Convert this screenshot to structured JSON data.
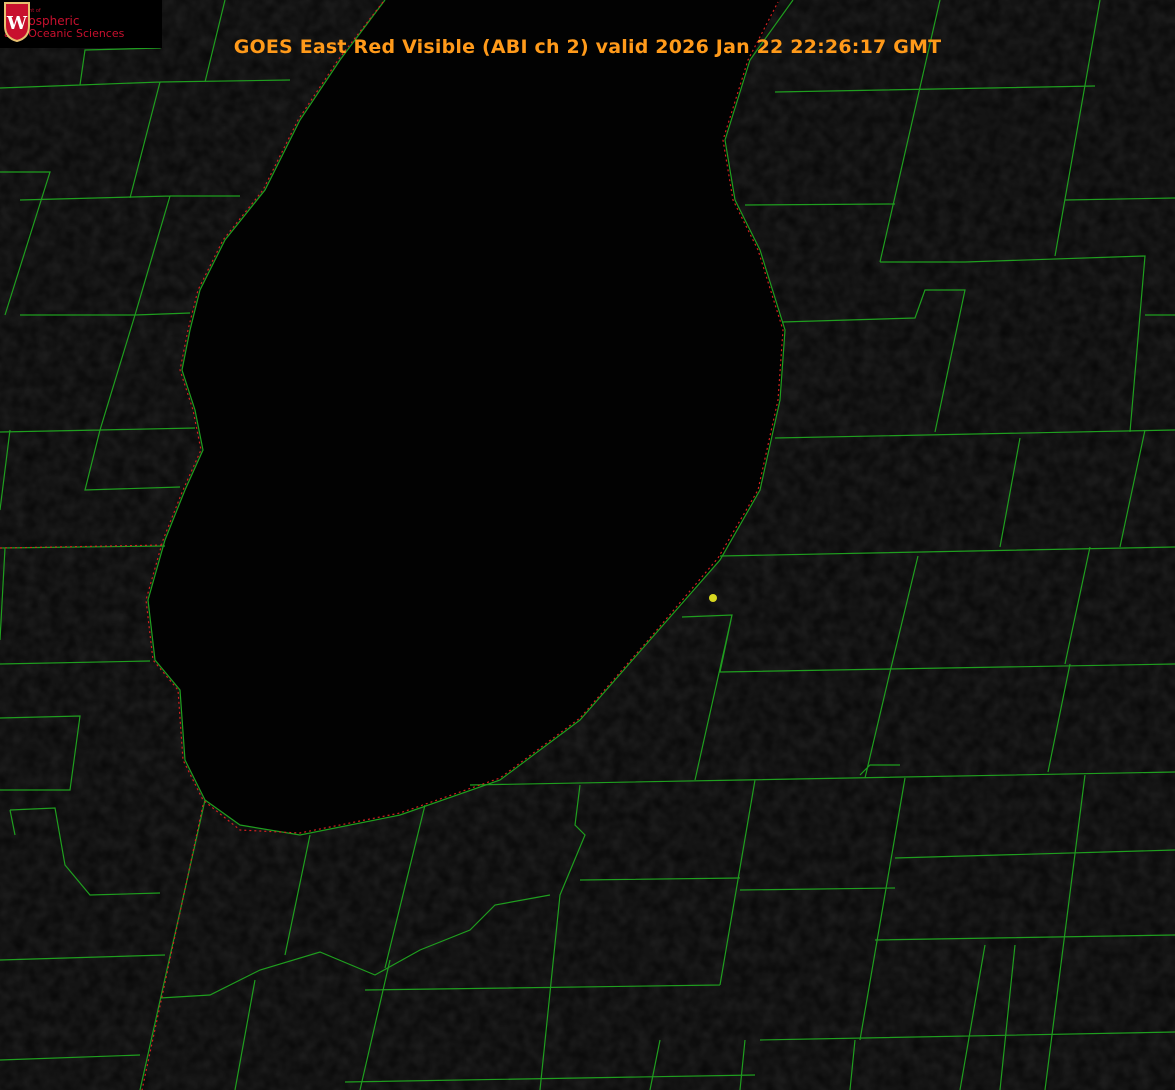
{
  "title": "GOES East Red Visible (ABI ch 2) valid 2026 Jan 22 22:26:17 GMT",
  "logo": {
    "line1": "Department of",
    "line2": "Atmospheric",
    "line3": "and Oceanic Sciences",
    "emblem": "W"
  },
  "colors": {
    "title": "#ff9a1a",
    "county_lines": "#1f9e1f",
    "shoreline_dotted": "#d22020",
    "marker": "#d8d820",
    "logo": "#c8102e"
  },
  "marker": {
    "icon": "station-dot-icon"
  }
}
